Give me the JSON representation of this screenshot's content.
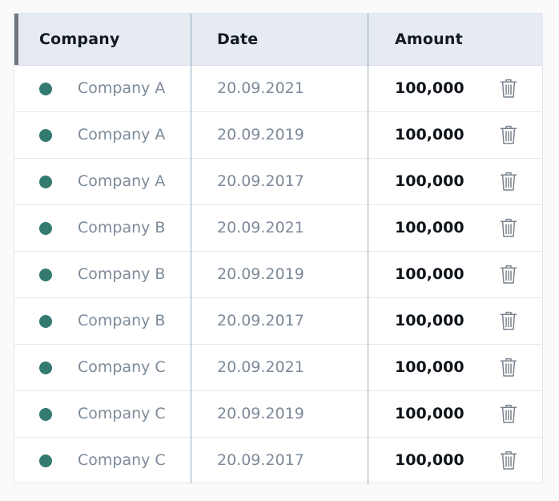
{
  "table": {
    "columns": {
      "company": "Company",
      "date": "Date",
      "amount": "Amount"
    },
    "status_dot_color": "#337a70",
    "rows": [
      {
        "company": "Company A",
        "date": "20.09.2021",
        "amount": "100,000"
      },
      {
        "company": "Company A",
        "date": "20.09.2019",
        "amount": "100,000"
      },
      {
        "company": "Company A",
        "date": "20.09.2017",
        "amount": "100,000"
      },
      {
        "company": "Company B",
        "date": "20.09.2021",
        "amount": "100,000"
      },
      {
        "company": "Company B",
        "date": "20.09.2019",
        "amount": "100,000"
      },
      {
        "company": "Company B",
        "date": "20.09.2017",
        "amount": "100,000"
      },
      {
        "company": "Company C",
        "date": "20.09.2021",
        "amount": "100,000"
      },
      {
        "company": "Company C",
        "date": "20.09.2019",
        "amount": "100,000"
      },
      {
        "company": "Company C",
        "date": "20.09.2017",
        "amount": "100,000"
      }
    ],
    "row_action_icon": "trash-icon"
  }
}
